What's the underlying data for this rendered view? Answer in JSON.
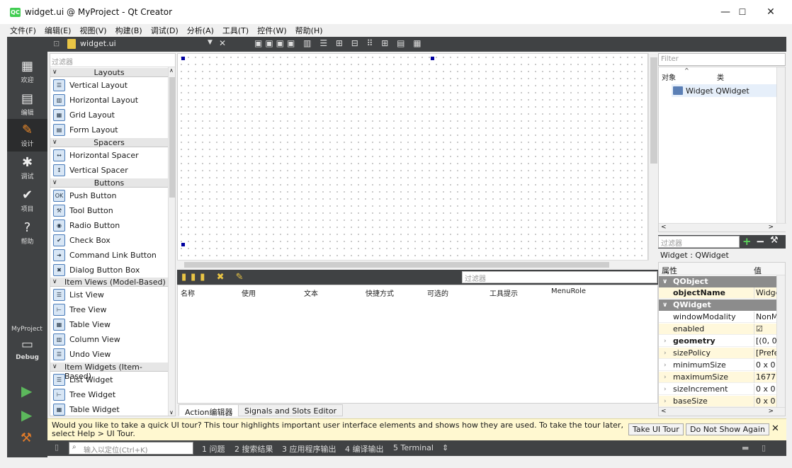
{
  "window": {
    "app_badge": "QC",
    "title": "widget.ui @ MyProject - Qt Creator",
    "minimize": "—",
    "maximize": "☐",
    "close": "✕"
  },
  "menu": [
    "文件(F)",
    "编辑(E)",
    "视图(V)",
    "构建(B)",
    "调试(D)",
    "分析(A)",
    "工具(T)",
    "控件(W)",
    "帮助(H)"
  ],
  "modes": [
    {
      "icon": "▦",
      "label": "欢迎"
    },
    {
      "icon": "▤",
      "label": "编辑"
    },
    {
      "icon": "✎",
      "label": "设计"
    },
    {
      "icon": "✱",
      "label": "调试"
    },
    {
      "icon": "✔",
      "label": "项目"
    },
    {
      "icon": "?",
      "label": "帮助"
    }
  ],
  "kit": {
    "project": "MyProject",
    "config": "Debug"
  },
  "editor": {
    "file": "widget.ui"
  },
  "widget_box": {
    "filter_placeholder": "过滤器",
    "categories": [
      {
        "name": "Layouts",
        "items": [
          "Vertical Layout",
          "Horizontal Layout",
          "Grid Layout",
          "Form Layout"
        ]
      },
      {
        "name": "Spacers",
        "items": [
          "Horizontal Spacer",
          "Vertical Spacer"
        ]
      },
      {
        "name": "Buttons",
        "items": [
          "Push Button",
          "Tool Button",
          "Radio Button",
          "Check Box",
          "Command Link Button",
          "Dialog Button Box"
        ]
      },
      {
        "name": "Item Views (Model-Based)",
        "items": [
          "List View",
          "Tree View",
          "Table View",
          "Column View",
          "Undo View"
        ]
      },
      {
        "name": "Item Widgets (Item-Based)",
        "items": [
          "List Widget",
          "Tree Widget",
          "Table Widget"
        ]
      }
    ]
  },
  "action_editor": {
    "filter_placeholder": "过滤器",
    "columns": [
      "名称",
      "使用",
      "文本",
      "快捷方式",
      "可选的",
      "工具提示",
      "MenuRole"
    ],
    "tabs": [
      "Action编辑器",
      "Signals and Slots Editor"
    ]
  },
  "object_inspector": {
    "filter_placeholder": "Filter",
    "columns": [
      "对象",
      "类"
    ],
    "rows": [
      {
        "object": "Widget",
        "class": "QWidget"
      }
    ]
  },
  "property_editor": {
    "filter_placeholder": "过滤器",
    "title": "Widget : QWidget",
    "columns": [
      "属性",
      "值"
    ],
    "sections": [
      {
        "name": "QObject",
        "props": [
          {
            "name": "objectName",
            "value": "Widge",
            "bold": true,
            "highlight": true
          }
        ]
      },
      {
        "name": "QWidget",
        "props": [
          {
            "name": "windowModality",
            "value": "NonM"
          },
          {
            "name": "enabled",
            "value": "☑",
            "highlight": true
          },
          {
            "name": "geometry",
            "value": "[(0, 0),",
            "bold": true,
            "expandable": true
          },
          {
            "name": "sizePolicy",
            "value": "[Prefe",
            "expandable": true,
            "highlight": true
          },
          {
            "name": "minimumSize",
            "value": "0 x 0",
            "expandable": true
          },
          {
            "name": "maximumSize",
            "value": "16777",
            "expandable": true,
            "highlight": true
          },
          {
            "name": "sizeIncrement",
            "value": "0 x 0",
            "expandable": true
          },
          {
            "name": "baseSize",
            "value": "0 x 0",
            "expandable": true,
            "highlight": true
          }
        ]
      }
    ]
  },
  "tour": {
    "message": "Would you like to take a quick UI tour? This tour highlights important user interface elements and shows how they are used. To take the tour later, select Help > UI Tour.",
    "take_tour": "Take UI Tour",
    "dont_show": "Do Not Show Again",
    "close": "✕"
  },
  "status_bar": {
    "locator_placeholder": "输入以定位(Ctrl+K)",
    "items": [
      "1 问题",
      "2 搜索结果",
      "3 应用程序输出",
      "4 编译输出",
      "5 Terminal"
    ]
  }
}
